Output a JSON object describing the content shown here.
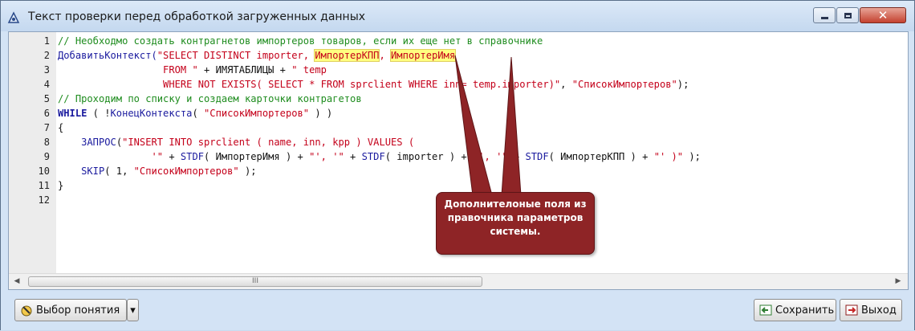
{
  "window": {
    "title": "Текст проверки перед обработкой загруженных данных",
    "controls": {
      "minimize": "minimize-icon",
      "maximize": "maximize-icon",
      "close": "close-icon"
    }
  },
  "editor": {
    "line_numbers": [
      "1",
      "2",
      "3",
      "4",
      "5",
      "6",
      "7",
      "8",
      "9",
      "10",
      "11",
      "12"
    ],
    "lines": [
      [
        {
          "t": "// Необходмо создать контрагнетов импортеров товаров, если их еще нет в справочнике",
          "c": "comment"
        }
      ],
      [
        {
          "t": "ДобавитьКонтекст(",
          "c": "fn"
        },
        {
          "t": "\"SELECT DISTINCT importer, ",
          "c": "string"
        },
        {
          "t": "ИмпортерКПП",
          "c": "hl"
        },
        {
          "t": ", ",
          "c": "string"
        },
        {
          "t": "ИмпортерИмя",
          "c": "hl"
        }
      ],
      [
        {
          "t": "                  FROM \"",
          "c": "string"
        },
        {
          "t": " + ИМЯТАБЛИЦЫ + ",
          "c": "plain"
        },
        {
          "t": "\" temp",
          "c": "string"
        }
      ],
      [
        {
          "t": "                  WHERE NOT EXISTS( SELECT * FROM sprclient WHERE inn= temp.importer)\"",
          "c": "string"
        },
        {
          "t": ", ",
          "c": "plain"
        },
        {
          "t": "\"СписокИмпортеров\"",
          "c": "string"
        },
        {
          "t": ");",
          "c": "plain"
        }
      ],
      [
        {
          "t": "// Проходим по списку и создаем карточки контрагетов",
          "c": "comment"
        }
      ],
      [
        {
          "t": "WHILE",
          "c": "kw"
        },
        {
          "t": " ( !",
          "c": "plain"
        },
        {
          "t": "КонецКонтекста",
          "c": "fn"
        },
        {
          "t": "( ",
          "c": "plain"
        },
        {
          "t": "\"СписокИмпортеров\"",
          "c": "string"
        },
        {
          "t": " ) )",
          "c": "plain"
        }
      ],
      [
        {
          "t": "{",
          "c": "plain"
        }
      ],
      [
        {
          "t": "    ",
          "c": "plain"
        },
        {
          "t": "ЗАПРОС",
          "c": "fn"
        },
        {
          "t": "(",
          "c": "plain"
        },
        {
          "t": "\"INSERT INTO sprclient ( name, inn, kpp ) VALUES (",
          "c": "string"
        }
      ],
      [
        {
          "t": "                '\"",
          "c": "string"
        },
        {
          "t": " + ",
          "c": "plain"
        },
        {
          "t": "STDF",
          "c": "fn"
        },
        {
          "t": "( ИмпортерИмя ) + ",
          "c": "plain"
        },
        {
          "t": "\"', '\"",
          "c": "string"
        },
        {
          "t": " + ",
          "c": "plain"
        },
        {
          "t": "STDF",
          "c": "fn"
        },
        {
          "t": "( importer ) + ",
          "c": "plain"
        },
        {
          "t": "\"', '\"",
          "c": "string"
        },
        {
          "t": " + ",
          "c": "plain"
        },
        {
          "t": "STDF",
          "c": "fn"
        },
        {
          "t": "( ИмпортерКПП ) + ",
          "c": "plain"
        },
        {
          "t": "\"' )\"",
          "c": "string"
        },
        {
          "t": " );",
          "c": "plain"
        }
      ],
      [
        {
          "t": "    ",
          "c": "plain"
        },
        {
          "t": "SKIP",
          "c": "fn"
        },
        {
          "t": "( 1, ",
          "c": "plain"
        },
        {
          "t": "\"СписокИмпортеров\"",
          "c": "string"
        },
        {
          "t": " );",
          "c": "plain"
        }
      ],
      [
        {
          "t": "}",
          "c": "plain"
        }
      ],
      []
    ]
  },
  "scrollbar": {
    "grip": "III"
  },
  "callout": {
    "text_lines": [
      "Дополнителоные поля из",
      "правочника параметров",
      "системы."
    ]
  },
  "buttons": {
    "concept_label": "Выбор понятия",
    "dropdown": "▾",
    "save_label": "Сохранить",
    "exit_label": "Выход"
  },
  "colors": {
    "comment": "#1e8c1e",
    "string": "#c4001a",
    "keyword": "#1a1a9e",
    "highlight": "#ffff80",
    "callout": "#8e2426"
  }
}
